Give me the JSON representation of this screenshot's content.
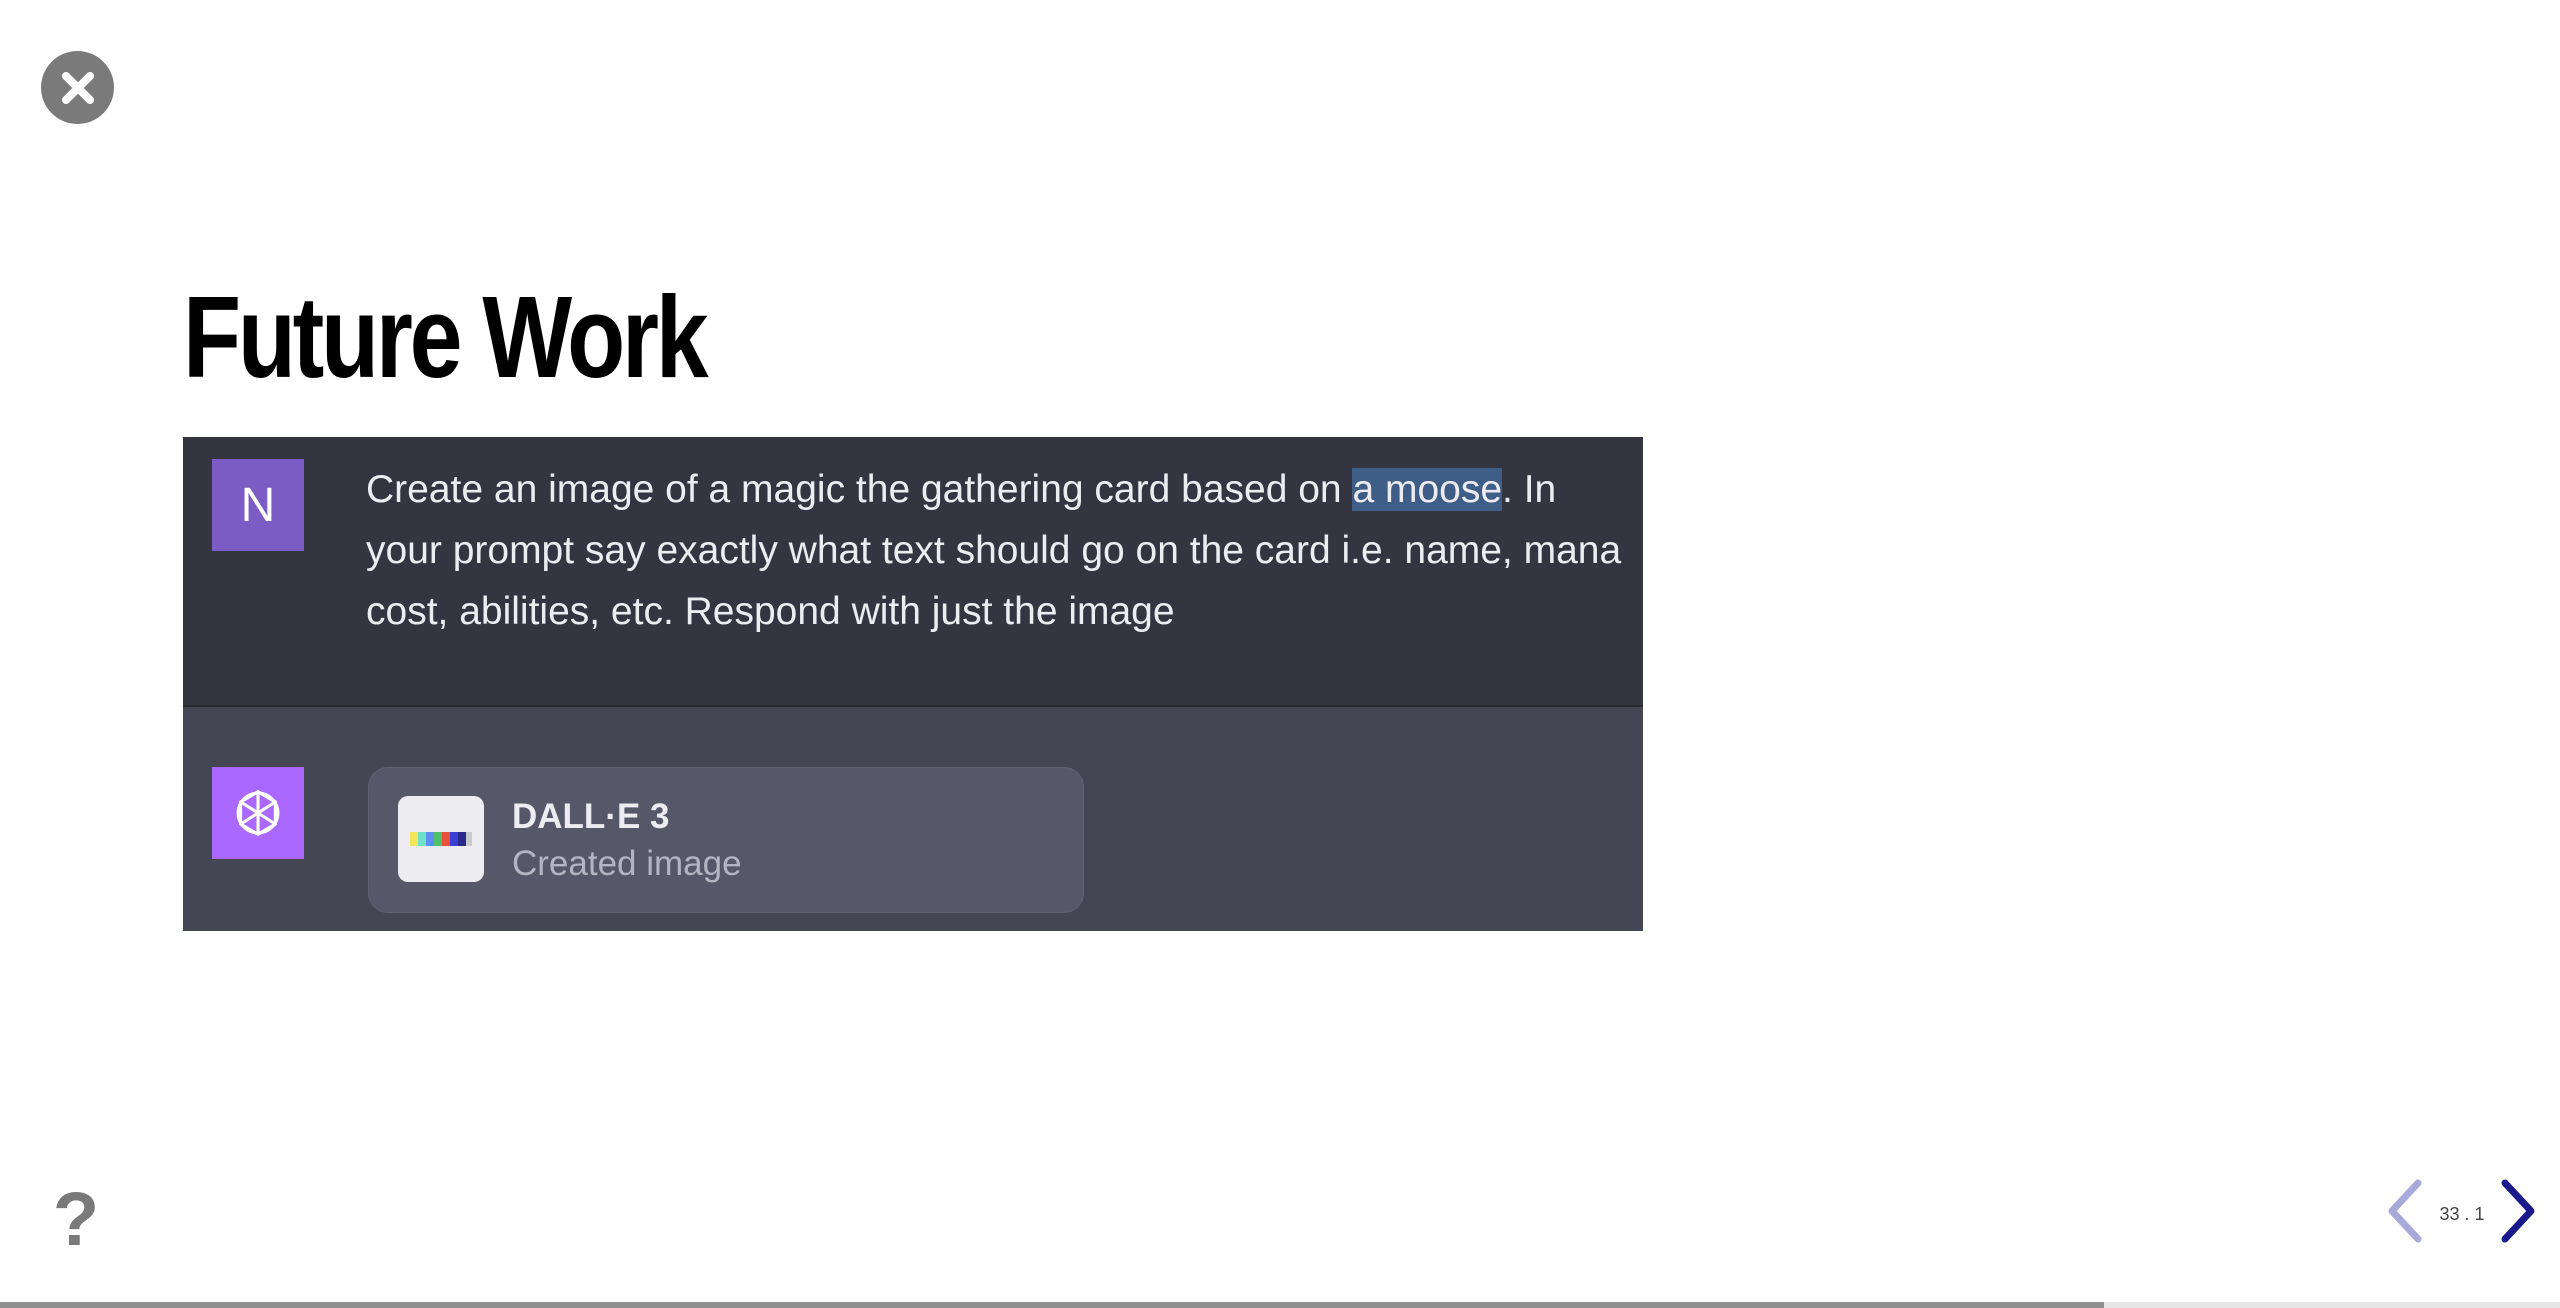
{
  "slide": {
    "title": "Future Work",
    "number": "33 . 1"
  },
  "chat": {
    "user_avatar_letter": "N",
    "user_message_before": "Create an image of a magic the gathering card based on ",
    "user_message_highlight": "a moose",
    "user_message_after": ". In your prompt say exactly what text should go on the card i.e. name, mana cost, abilities, etc. Respond with just the image",
    "tool_title": "DALL·E 3",
    "tool_subtitle": "Created image"
  },
  "controls": {
    "help_glyph": "?"
  },
  "progress": {
    "fraction": 0.822
  },
  "colors": {
    "accent_nav": "#1a1a8c",
    "nav_disabled": "#a9a9d9",
    "user_bg": "#343541",
    "assistant_bg": "#444654",
    "user_avatar": "#7b5bc4",
    "gpt_avatar": "#ab68ff",
    "highlight": "#3f5e87"
  },
  "icons": {
    "close": "close-icon",
    "help": "help-icon",
    "prev": "chevron-left-icon",
    "next": "chevron-right-icon",
    "gpt": "openai-logo-icon",
    "thumb": "image-thumbnail-icon"
  }
}
